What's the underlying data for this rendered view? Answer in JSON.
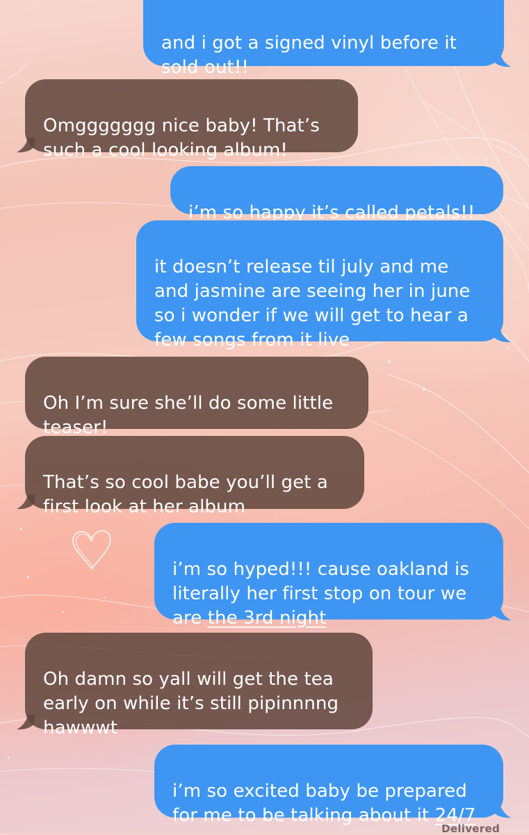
{
  "messages": [
    {
      "direction": "sent",
      "text": "and i got a signed vinyl before it\nsold out!!"
    },
    {
      "direction": "received",
      "text": "Omggggggg nice baby! That’s\nsuch a cool looking album!"
    },
    {
      "direction": "sent",
      "text": "i’m so happy it’s called petals!!"
    },
    {
      "direction": "sent",
      "text": "it doesn’t release til july and me\nand jasmine are seeing her in june\nso i wonder if we will get to hear a\nfew songs from it live"
    },
    {
      "direction": "received",
      "text": "Oh I’m sure she’ll do some little\nteaser!"
    },
    {
      "direction": "received",
      "text": "That’s so cool babe you’ll get a\nfirst look at her album"
    },
    {
      "direction": "sent",
      "text_before_link": "i’m so hyped!!! cause oakland is\nliterally her first stop on tour we\nare ",
      "link": "the 3rd night"
    },
    {
      "direction": "received",
      "text": "Oh damn so yall will get the tea\nearly on while it’s still pipinnnng\nhawwwt"
    },
    {
      "direction": "sent",
      "text_before_link": "i’m so excited baby be prepared\nfor me to be talking about it ",
      "link": "24/7"
    }
  ],
  "status": {
    "delivered": "Delivered"
  },
  "colors": {
    "sent_bubble": "#3f96f2",
    "received_bubble": "#60463c",
    "bubble_text": "#ffffff"
  },
  "icons": {
    "wallpaper_heart": "heart-doodle-icon"
  }
}
